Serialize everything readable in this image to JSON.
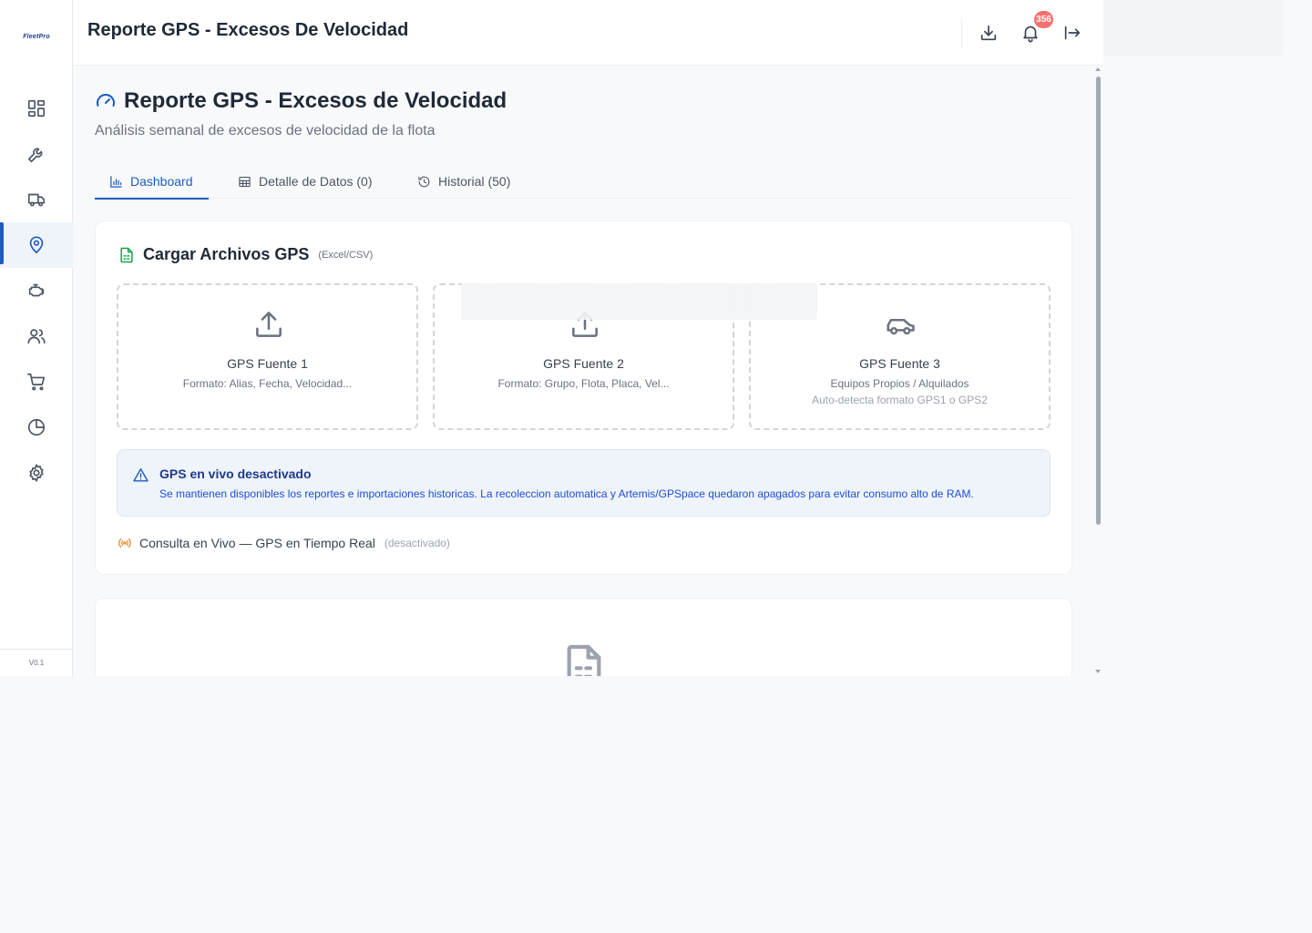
{
  "app": {
    "logo_text": "FleetPro",
    "version": "V0.1"
  },
  "header": {
    "title": "Reporte GPS - Excesos De Velocidad",
    "notification_count": "356",
    "icons": [
      "download-icon",
      "bell-icon",
      "logout-icon"
    ]
  },
  "sidebar": {
    "items": [
      {
        "name": "dashboard",
        "icon": "grid-icon",
        "active": false
      },
      {
        "name": "mantenimiento",
        "icon": "wrench-icon",
        "active": false
      },
      {
        "name": "vehiculos",
        "icon": "truck-icon",
        "active": false
      },
      {
        "name": "gps",
        "icon": "map-pin-icon",
        "active": true
      },
      {
        "name": "motor",
        "icon": "engine-icon",
        "active": false
      },
      {
        "name": "usuarios",
        "icon": "users-icon",
        "active": false
      },
      {
        "name": "compras",
        "icon": "cart-icon",
        "active": false
      },
      {
        "name": "reportes",
        "icon": "pie-chart-icon",
        "active": false
      },
      {
        "name": "configuracion",
        "icon": "gear-icon",
        "active": false
      }
    ]
  },
  "page": {
    "title": "Reporte GPS - Excesos de Velocidad",
    "subtitle": "Análisis semanal de excesos de velocidad de la flota",
    "accent_color": "#1d5cc0"
  },
  "tabs": [
    {
      "label": "Dashboard",
      "icon": "bar-chart-icon",
      "active": true
    },
    {
      "label": "Detalle de Datos (0)",
      "icon": "table-icon",
      "active": false
    },
    {
      "label": "Historial (50)",
      "icon": "history-icon",
      "active": false
    }
  ],
  "upload_card": {
    "title": "Cargar Archivos GPS",
    "hint": "(Excel/CSV)",
    "sources": [
      {
        "title": "GPS Fuente 1",
        "subtitle": "Formato: Alias, Fecha, Velocidad...",
        "icon": "upload-icon"
      },
      {
        "title": "GPS Fuente 2",
        "subtitle": "Formato: Grupo, Flota, Placa, Vel...",
        "icon": "upload-icon"
      },
      {
        "title": "GPS Fuente 3",
        "subtitle": "Equipos Propios / Alquilados",
        "subtitle2": "Auto-detecta formato GPS1 o GPS2",
        "icon": "car-icon"
      }
    ]
  },
  "alert": {
    "title": "GPS en vivo desactivado",
    "text": "Se mantienen disponibles los reportes e importaciones historicas. La recoleccion automatica y Artemis/GPSpace quedaron apagados para evitar consumo alto de RAM."
  },
  "live": {
    "label": "Consulta en Vivo — GPS en Tiempo Real",
    "state": "(desactivado)"
  }
}
